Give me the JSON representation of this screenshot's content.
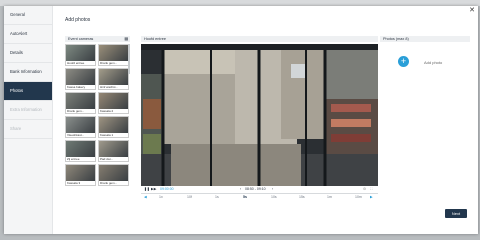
{
  "background": {
    "ghost_labels": [
      "",
      "",
      "",
      "",
      "",
      "",
      "",
      "",
      "",
      ""
    ]
  },
  "sidebar": {
    "items": [
      {
        "label": "General",
        "state": "normal"
      },
      {
        "label": "AutoAlert",
        "state": "normal"
      },
      {
        "label": "Details",
        "state": "normal"
      },
      {
        "label": "Bank Information",
        "state": "normal"
      },
      {
        "label": "Photos",
        "state": "active"
      },
      {
        "label": "Extra Information",
        "state": "disabled"
      },
      {
        "label": "Share",
        "state": "disabled"
      }
    ]
  },
  "main": {
    "title": "Add photos"
  },
  "event_cameras": {
    "header": "Event cameras",
    "cameras": [
      {
        "label": "Hoofd entree",
        "tone": "#7e8a82"
      },
      {
        "label": "Drank gem...",
        "tone": "#9a8f7a"
      },
      {
        "label": "Kassa bakery",
        "tone": "#8d8c84"
      },
      {
        "label": "Hinf wachst...",
        "tone": "#a39c8a"
      },
      {
        "label": "Drank gem...",
        "tone": "#7b7f78"
      },
      {
        "label": "Kassala 2",
        "tone": "#958774"
      },
      {
        "label": "Vleeshkast...",
        "tone": "#8a8f8c"
      },
      {
        "label": "Kassala 1",
        "tone": "#9e9482"
      },
      {
        "label": "Zij entree",
        "tone": "#6f7a74"
      },
      {
        "label": "Pad vlei...",
        "tone": "#a09a8c"
      },
      {
        "label": "Kassala 3",
        "tone": "#8f887a"
      },
      {
        "label": "Drank gem...",
        "tone": "#857d70"
      }
    ]
  },
  "player": {
    "header": "Hoofd entree",
    "timestamp": "09:00:00",
    "range": "08:50 - 09:10",
    "speeds": [
      "1x",
      "10f",
      "1s",
      "5s",
      "10s",
      "15s",
      "1m",
      "10m"
    ],
    "active_speed": "5s",
    "accent": "#2a9fd8"
  },
  "photos": {
    "header": "Photos (max 8)",
    "add_label": "Add photo"
  },
  "footer": {
    "next_label": "Next"
  }
}
